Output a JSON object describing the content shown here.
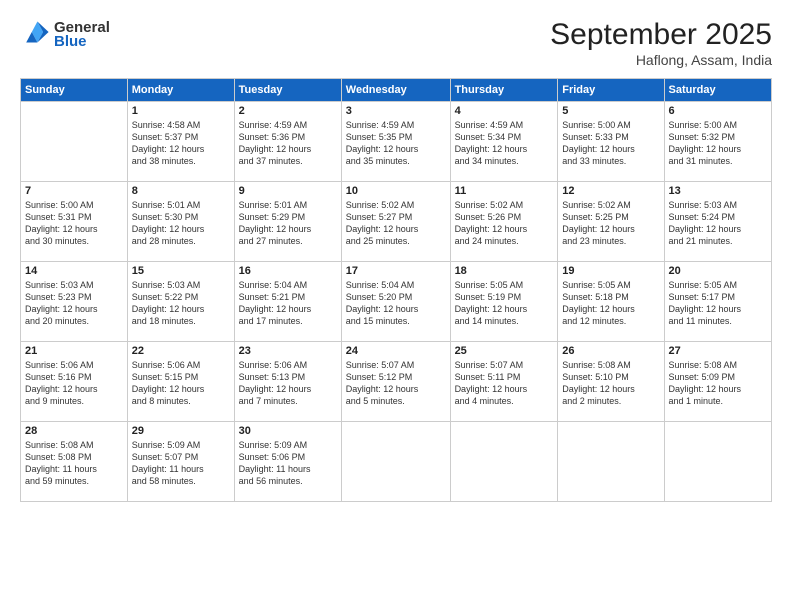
{
  "header": {
    "logo_general": "General",
    "logo_blue": "Blue",
    "month_title": "September 2025",
    "location": "Haflong, Assam, India"
  },
  "days_of_week": [
    "Sunday",
    "Monday",
    "Tuesday",
    "Wednesday",
    "Thursday",
    "Friday",
    "Saturday"
  ],
  "weeks": [
    [
      {
        "day": "",
        "info": ""
      },
      {
        "day": "1",
        "info": "Sunrise: 4:58 AM\nSunset: 5:37 PM\nDaylight: 12 hours\nand 38 minutes."
      },
      {
        "day": "2",
        "info": "Sunrise: 4:59 AM\nSunset: 5:36 PM\nDaylight: 12 hours\nand 37 minutes."
      },
      {
        "day": "3",
        "info": "Sunrise: 4:59 AM\nSunset: 5:35 PM\nDaylight: 12 hours\nand 35 minutes."
      },
      {
        "day": "4",
        "info": "Sunrise: 4:59 AM\nSunset: 5:34 PM\nDaylight: 12 hours\nand 34 minutes."
      },
      {
        "day": "5",
        "info": "Sunrise: 5:00 AM\nSunset: 5:33 PM\nDaylight: 12 hours\nand 33 minutes."
      },
      {
        "day": "6",
        "info": "Sunrise: 5:00 AM\nSunset: 5:32 PM\nDaylight: 12 hours\nand 31 minutes."
      }
    ],
    [
      {
        "day": "7",
        "info": "Sunrise: 5:00 AM\nSunset: 5:31 PM\nDaylight: 12 hours\nand 30 minutes."
      },
      {
        "day": "8",
        "info": "Sunrise: 5:01 AM\nSunset: 5:30 PM\nDaylight: 12 hours\nand 28 minutes."
      },
      {
        "day": "9",
        "info": "Sunrise: 5:01 AM\nSunset: 5:29 PM\nDaylight: 12 hours\nand 27 minutes."
      },
      {
        "day": "10",
        "info": "Sunrise: 5:02 AM\nSunset: 5:27 PM\nDaylight: 12 hours\nand 25 minutes."
      },
      {
        "day": "11",
        "info": "Sunrise: 5:02 AM\nSunset: 5:26 PM\nDaylight: 12 hours\nand 24 minutes."
      },
      {
        "day": "12",
        "info": "Sunrise: 5:02 AM\nSunset: 5:25 PM\nDaylight: 12 hours\nand 23 minutes."
      },
      {
        "day": "13",
        "info": "Sunrise: 5:03 AM\nSunset: 5:24 PM\nDaylight: 12 hours\nand 21 minutes."
      }
    ],
    [
      {
        "day": "14",
        "info": "Sunrise: 5:03 AM\nSunset: 5:23 PM\nDaylight: 12 hours\nand 20 minutes."
      },
      {
        "day": "15",
        "info": "Sunrise: 5:03 AM\nSunset: 5:22 PM\nDaylight: 12 hours\nand 18 minutes."
      },
      {
        "day": "16",
        "info": "Sunrise: 5:04 AM\nSunset: 5:21 PM\nDaylight: 12 hours\nand 17 minutes."
      },
      {
        "day": "17",
        "info": "Sunrise: 5:04 AM\nSunset: 5:20 PM\nDaylight: 12 hours\nand 15 minutes."
      },
      {
        "day": "18",
        "info": "Sunrise: 5:05 AM\nSunset: 5:19 PM\nDaylight: 12 hours\nand 14 minutes."
      },
      {
        "day": "19",
        "info": "Sunrise: 5:05 AM\nSunset: 5:18 PM\nDaylight: 12 hours\nand 12 minutes."
      },
      {
        "day": "20",
        "info": "Sunrise: 5:05 AM\nSunset: 5:17 PM\nDaylight: 12 hours\nand 11 minutes."
      }
    ],
    [
      {
        "day": "21",
        "info": "Sunrise: 5:06 AM\nSunset: 5:16 PM\nDaylight: 12 hours\nand 9 minutes."
      },
      {
        "day": "22",
        "info": "Sunrise: 5:06 AM\nSunset: 5:15 PM\nDaylight: 12 hours\nand 8 minutes."
      },
      {
        "day": "23",
        "info": "Sunrise: 5:06 AM\nSunset: 5:13 PM\nDaylight: 12 hours\nand 7 minutes."
      },
      {
        "day": "24",
        "info": "Sunrise: 5:07 AM\nSunset: 5:12 PM\nDaylight: 12 hours\nand 5 minutes."
      },
      {
        "day": "25",
        "info": "Sunrise: 5:07 AM\nSunset: 5:11 PM\nDaylight: 12 hours\nand 4 minutes."
      },
      {
        "day": "26",
        "info": "Sunrise: 5:08 AM\nSunset: 5:10 PM\nDaylight: 12 hours\nand 2 minutes."
      },
      {
        "day": "27",
        "info": "Sunrise: 5:08 AM\nSunset: 5:09 PM\nDaylight: 12 hours\nand 1 minute."
      }
    ],
    [
      {
        "day": "28",
        "info": "Sunrise: 5:08 AM\nSunset: 5:08 PM\nDaylight: 11 hours\nand 59 minutes."
      },
      {
        "day": "29",
        "info": "Sunrise: 5:09 AM\nSunset: 5:07 PM\nDaylight: 11 hours\nand 58 minutes."
      },
      {
        "day": "30",
        "info": "Sunrise: 5:09 AM\nSunset: 5:06 PM\nDaylight: 11 hours\nand 56 minutes."
      },
      {
        "day": "",
        "info": ""
      },
      {
        "day": "",
        "info": ""
      },
      {
        "day": "",
        "info": ""
      },
      {
        "day": "",
        "info": ""
      }
    ]
  ]
}
